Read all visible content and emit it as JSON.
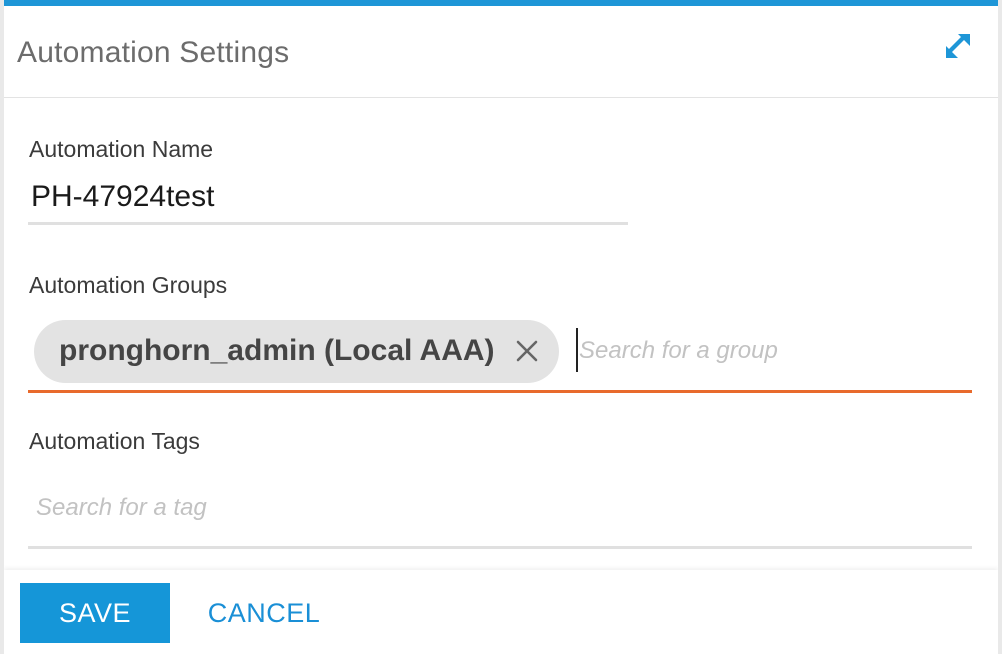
{
  "dialog": {
    "title": "Automation Settings",
    "expand_icon": "expand-icon"
  },
  "fields": {
    "name": {
      "label": "Automation Name",
      "value": "PH-47924test"
    },
    "groups": {
      "label": "Automation Groups",
      "chips": [
        {
          "label": "pronghorn_admin (Local AAA)"
        }
      ],
      "placeholder": "Search for a group"
    },
    "tags": {
      "label": "Automation Tags",
      "placeholder": "Search for a tag"
    }
  },
  "footer": {
    "save_label": "SAVE",
    "cancel_label": "CANCEL"
  },
  "colors": {
    "accent": "#1e96d7",
    "focus_underline": "#e86a2c",
    "chip_bg": "#e3e3e3"
  }
}
